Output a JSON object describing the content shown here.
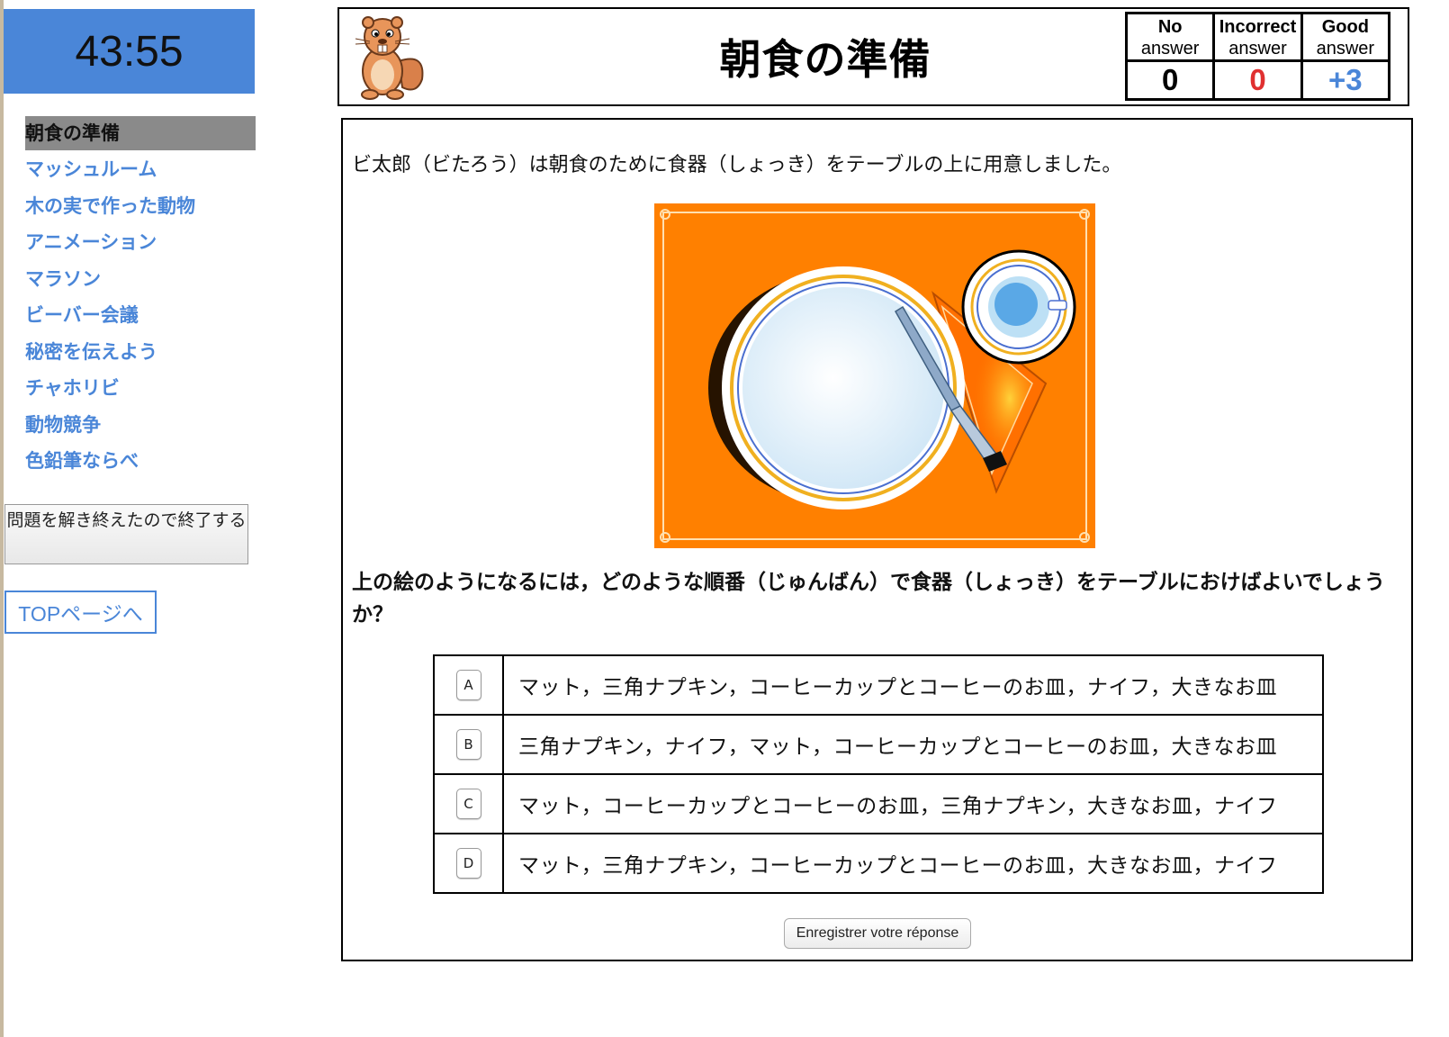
{
  "timer": "43:55",
  "sidebar": {
    "tasks": [
      {
        "label": "朝食の準備",
        "current": true
      },
      {
        "label": "マッシュルーム"
      },
      {
        "label": "木の実で作った動物"
      },
      {
        "label": "アニメーション"
      },
      {
        "label": "マラソン"
      },
      {
        "label": "ビーバー会議"
      },
      {
        "label": "秘密を伝えよう"
      },
      {
        "label": "チャホリビ"
      },
      {
        "label": "動物競争"
      },
      {
        "label": "色鉛筆ならべ"
      }
    ],
    "finish_label": "問題を解き終えたので終了する",
    "top_link": "TOPページへ"
  },
  "header": {
    "title": "朝食の準備",
    "scores": [
      {
        "line1": "No",
        "line2": "answer",
        "value": "0",
        "color": "#000000"
      },
      {
        "line1": "Incorrect",
        "line2": "answer",
        "value": "0",
        "color": "#e03030"
      },
      {
        "line1": "Good",
        "line2": "answer",
        "value": "+3",
        "color": "#4a86d8"
      }
    ]
  },
  "task": {
    "intro": "ビ太郎（ビたろう）は朝食のために食器（しょっき）をテーブルの上に用意しました。",
    "question": "上の絵のようになるには，どのような順番（じゅんばん）で食器（しょっき）をテーブルにおけばよいでしょうか？",
    "choices": [
      {
        "key": "A",
        "text": "マット，三角ナプキン，コーヒーカップとコーヒーのお皿，ナイフ，大きなお皿"
      },
      {
        "key": "B",
        "text": "三角ナプキン，ナイフ，マット，コーヒーカップとコーヒーのお皿，大きなお皿"
      },
      {
        "key": "C",
        "text": "マット，コーヒーカップとコーヒーのお皿，三角ナプキン，大きなお皿，ナイフ"
      },
      {
        "key": "D",
        "text": "マット，三角ナプキン，コーヒーカップとコーヒーのお皿，大きなお皿，ナイフ"
      }
    ],
    "submit_label": "Enregistrer votre réponse"
  },
  "colors": {
    "accent": "#4a86d8",
    "mat": "#ff8000",
    "incorrect": "#e03030"
  }
}
